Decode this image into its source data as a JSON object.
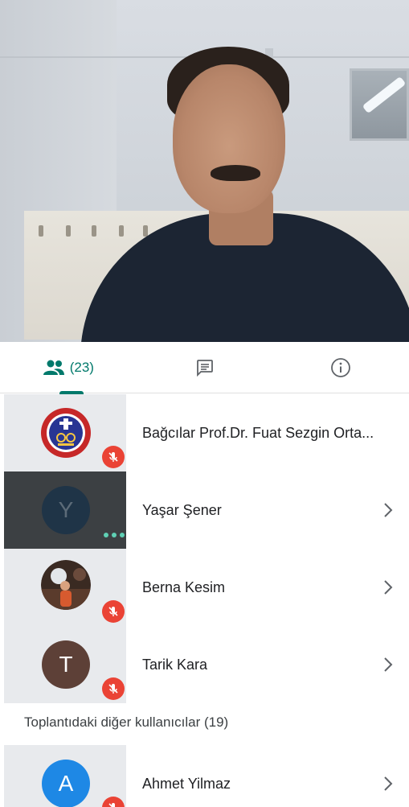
{
  "tabs": {
    "people_count": "(23)",
    "people_icon": "people-icon",
    "chat_icon": "chat-icon",
    "info_icon": "info-icon",
    "accent_color": "#00796b"
  },
  "participants": [
    {
      "name": "Bağcılar Prof.Dr. Fuat Sezgin Orta...",
      "avatar": "school-logo",
      "muted": true
    },
    {
      "name": "Yaşar Şener",
      "avatar_letter": "Y",
      "speaking": true
    },
    {
      "name": "Berna Kesim",
      "avatar": "photo",
      "muted": true
    },
    {
      "name": "Tarik Kara",
      "avatar_letter": "T",
      "muted": true
    }
  ],
  "others": {
    "label": "Toplantıdaki diğer kullanıcılar (19)",
    "participants": [
      {
        "name": "Ahmet Yilmaz",
        "avatar_letter": "A",
        "muted": true
      }
    ]
  },
  "colors": {
    "mute_red": "#ea4335",
    "avatar_y": "#1f3447",
    "avatar_t": "#5d4037",
    "avatar_a": "#1e88e5"
  }
}
